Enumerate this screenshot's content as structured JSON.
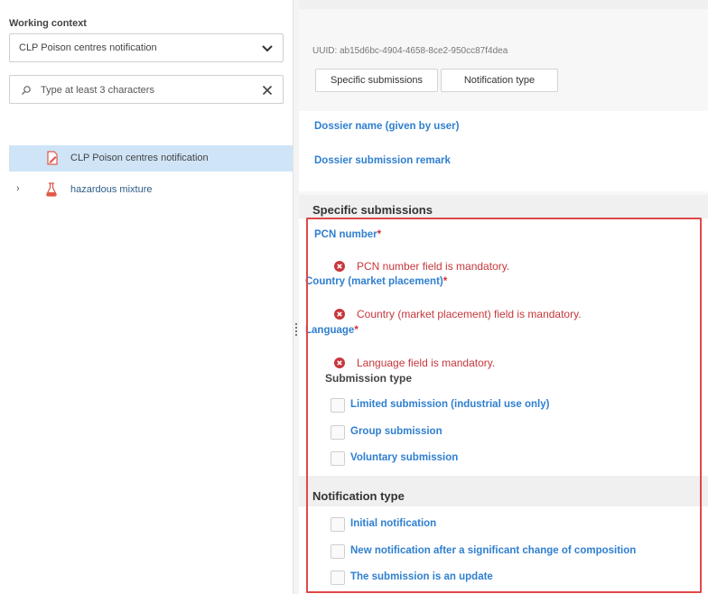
{
  "sidebar": {
    "working_context_label": "Working context",
    "working_context_value": "CLP Poison centres notification",
    "search_placeholder": "Type at least 3 characters",
    "tree": [
      {
        "label": "CLP Poison centres notification",
        "selected": true,
        "icon": "document-edit-icon"
      },
      {
        "label": "hazardous mixture",
        "selected": false,
        "icon": "flask-icon",
        "expander": "›"
      }
    ]
  },
  "main": {
    "uuid": "UUID: ab15d6bc-4904-4658-8ce2-950cc87f4dea",
    "tabs": [
      "Specific submissions",
      "Notification type"
    ],
    "dossier_name_label": "Dossier name (given by user)",
    "dossier_remark_label": "Dossier submission remark",
    "specific_submissions": {
      "title": "Specific submissions",
      "pcn_label": "PCN number",
      "pcn_error": "PCN number field is mandatory.",
      "country_label": "Country (market placement)",
      "country_error": "Country (market placement) field is mandatory.",
      "language_label": "Language",
      "language_error": "Language field is mandatory.",
      "required_mark": "*",
      "submission_type_label": "Submission type",
      "submission_options": [
        "Limited submission (industrial use only)",
        "Group submission",
        "Voluntary submission"
      ]
    },
    "notification_type": {
      "title": "Notification type",
      "options": [
        "Initial notification",
        "New notification after a significant change of composition",
        "The submission is an update"
      ]
    }
  },
  "colors": {
    "accent_link": "#2f7fd0",
    "error": "#c6373b",
    "highlight_border": "#e04848",
    "selected_row": "#cfe4f7"
  }
}
